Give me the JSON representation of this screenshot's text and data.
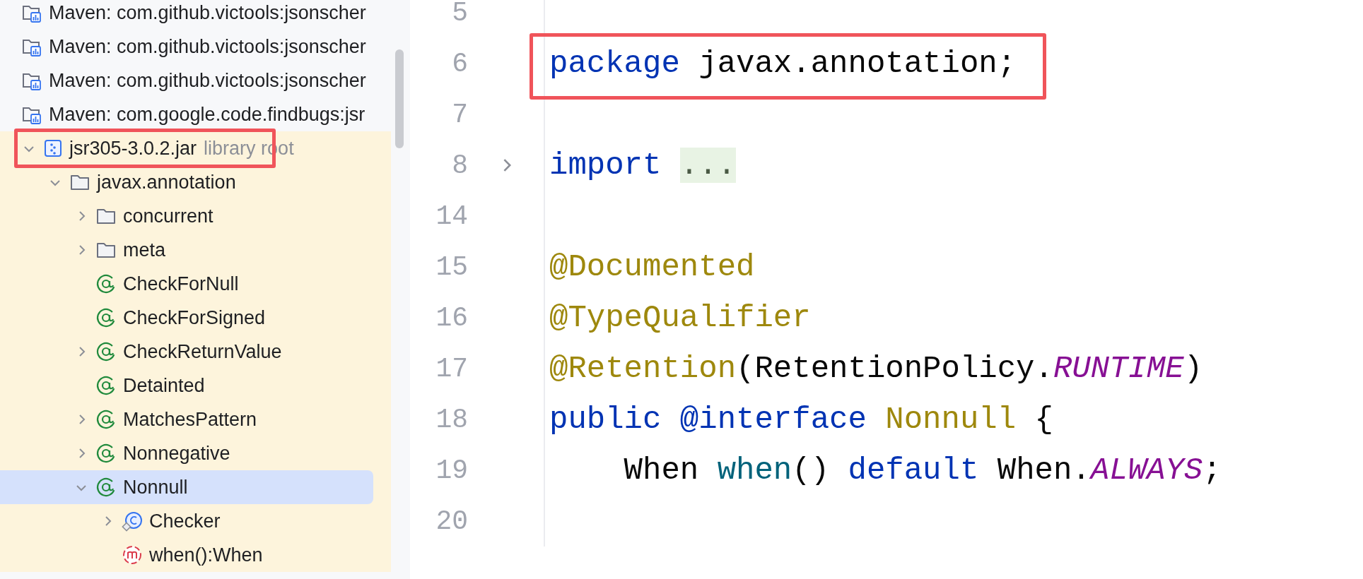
{
  "project_tree": {
    "items": [
      {
        "kind": "library",
        "label": "Maven: com.github.victools:jsonscher",
        "selected": false
      },
      {
        "kind": "library",
        "label": "Maven: com.github.victools:jsonscher",
        "selected": false
      },
      {
        "kind": "library",
        "label": "Maven: com.github.victools:jsonscher",
        "selected": false
      },
      {
        "kind": "library",
        "label": "Maven: com.google.code.findbugs:jsr",
        "selected": false,
        "children": [
          {
            "kind": "jar",
            "label": "jsr305-3.0.2.jar",
            "hint": "library root",
            "expanded": true,
            "highlighted": true,
            "selected": false,
            "children": [
              {
                "kind": "package",
                "label": "javax.annotation",
                "expanded": true,
                "selected": false,
                "children": [
                  {
                    "kind": "package",
                    "label": "concurrent",
                    "expanded": false,
                    "selected": false
                  },
                  {
                    "kind": "package",
                    "label": "meta",
                    "expanded": false,
                    "selected": false
                  },
                  {
                    "kind": "annotation",
                    "label": "CheckForNull",
                    "selected": false
                  },
                  {
                    "kind": "annotation",
                    "label": "CheckForSigned",
                    "selected": false
                  },
                  {
                    "kind": "annotation",
                    "label": "CheckReturnValue",
                    "expanded": false,
                    "selected": false
                  },
                  {
                    "kind": "annotation",
                    "label": "Detainted",
                    "selected": false
                  },
                  {
                    "kind": "annotation",
                    "label": "MatchesPattern",
                    "expanded": false,
                    "selected": false
                  },
                  {
                    "kind": "annotation",
                    "label": "Nonnegative",
                    "expanded": false,
                    "selected": false
                  },
                  {
                    "kind": "annotation",
                    "label": "Nonnull",
                    "expanded": true,
                    "selected": true,
                    "children": [
                      {
                        "kind": "class",
                        "label": "Checker",
                        "expanded": false,
                        "selected": false
                      },
                      {
                        "kind": "method",
                        "label": "when():When",
                        "selected": false
                      }
                    ]
                  }
                ]
              }
            ]
          }
        ]
      }
    ]
  },
  "editor": {
    "lines": [
      {
        "number": "5"
      },
      {
        "number": "6",
        "highlighted": true,
        "tokens": [
          {
            "kind": "keyword",
            "text": "package"
          },
          {
            "kind": "plain",
            "text": " javax.annotation;"
          }
        ]
      },
      {
        "number": "7"
      },
      {
        "number": "8",
        "folded": true,
        "tokens": [
          {
            "kind": "keyword",
            "text": "import"
          },
          {
            "kind": "fold",
            "text": "..."
          }
        ]
      },
      {
        "number": "14"
      },
      {
        "number": "15",
        "tokens": [
          {
            "kind": "annotation",
            "text": "@Documented"
          }
        ]
      },
      {
        "number": "16",
        "tokens": [
          {
            "kind": "annotation",
            "text": "@TypeQualifier"
          }
        ]
      },
      {
        "number": "17",
        "tokens": [
          {
            "kind": "annotation",
            "text": "@Retention"
          },
          {
            "kind": "plain",
            "text": "(RetentionPolicy."
          },
          {
            "kind": "constant",
            "text": "RUNTIME"
          },
          {
            "kind": "plain",
            "text": ")"
          }
        ]
      },
      {
        "number": "18",
        "tokens": [
          {
            "kind": "keyword",
            "text": "public @interface "
          },
          {
            "kind": "annotation",
            "text": "Nonnull"
          },
          {
            "kind": "plain",
            "text": " {"
          }
        ]
      },
      {
        "number": "19",
        "tokens": [
          {
            "kind": "plain",
            "text": "    When "
          },
          {
            "kind": "method",
            "text": "when"
          },
          {
            "kind": "plain",
            "text": "() "
          },
          {
            "kind": "keyword",
            "text": "default"
          },
          {
            "kind": "plain",
            "text": " When."
          },
          {
            "kind": "constant",
            "text": "ALWAYS"
          },
          {
            "kind": "plain",
            "text": ";"
          }
        ]
      },
      {
        "number": "20"
      }
    ]
  }
}
